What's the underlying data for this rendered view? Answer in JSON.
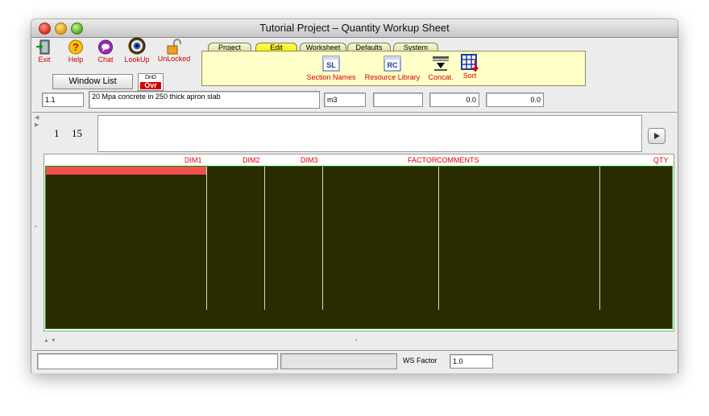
{
  "window": {
    "title": "Tutorial Project – Quantity Workup Sheet"
  },
  "toolbar": {
    "exit": "Exit",
    "help": "Help",
    "chat": "Chat",
    "lookup": "LookUp",
    "unlocked": "UnLocked",
    "window_list": "Window List",
    "dnd_top": "DnD",
    "dnd_bottom": "Ovr"
  },
  "tabs": [
    "Project",
    "Edit",
    "Worksheet",
    "Defaults",
    "System"
  ],
  "active_tab": "Edit",
  "ribbon": {
    "section_names": "Section Names",
    "section_icon": "SL",
    "resource_library": "Resource Library",
    "resource_icon": "RC",
    "concat": "Concat.",
    "sort": "Sort"
  },
  "item": {
    "code": "1.1",
    "description": "20 Mpa concrete in 250 thick apron slab",
    "unit": "m3",
    "blank": "",
    "value1": "0.0",
    "value2": "0.0"
  },
  "worksheet": {
    "ref_a": "1",
    "ref_b": "15",
    "columns": [
      "DIM1",
      "DIM2",
      "DIM3",
      "FACTOR",
      "COMMENTS",
      "QTY"
    ]
  },
  "status": {
    "message": "",
    "info": "",
    "ws_factor_label": "WS Factor",
    "ws_factor_value": "1.0"
  },
  "colors": {
    "accent": "#d00000",
    "grid_bg": "#2b2b00",
    "selected_row": "#f05050",
    "ribbon_bg": "#ffffc8"
  }
}
